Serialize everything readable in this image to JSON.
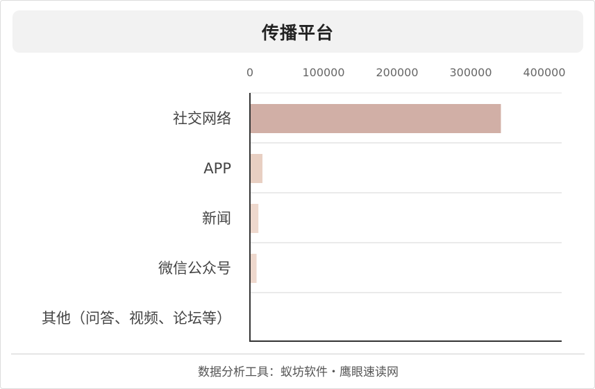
{
  "footer": "数据分析工具：蚁坊软件・鹰眼速读网",
  "chart_data": {
    "type": "bar",
    "orientation": "horizontal",
    "title": "传播平台",
    "categories": [
      "社交网络",
      "APP",
      "新闻",
      "微信公众号",
      "其他（问答、视频、论坛等）"
    ],
    "values": [
      341000,
      17000,
      11500,
      9000,
      0
    ],
    "colors": [
      "#d1afa6",
      "#e8cfc2",
      "#eed8cd",
      "#eed8cd",
      "#eed8cd"
    ],
    "xlim": [
      0,
      400000
    ],
    "xticks": [
      0,
      100000,
      200000,
      300000,
      400000
    ],
    "xtick_labels": [
      "0",
      "100000",
      "200000",
      "300000",
      "400000"
    ],
    "xaxis_position": "top",
    "grid": "horizontal separators",
    "legend": "none"
  }
}
